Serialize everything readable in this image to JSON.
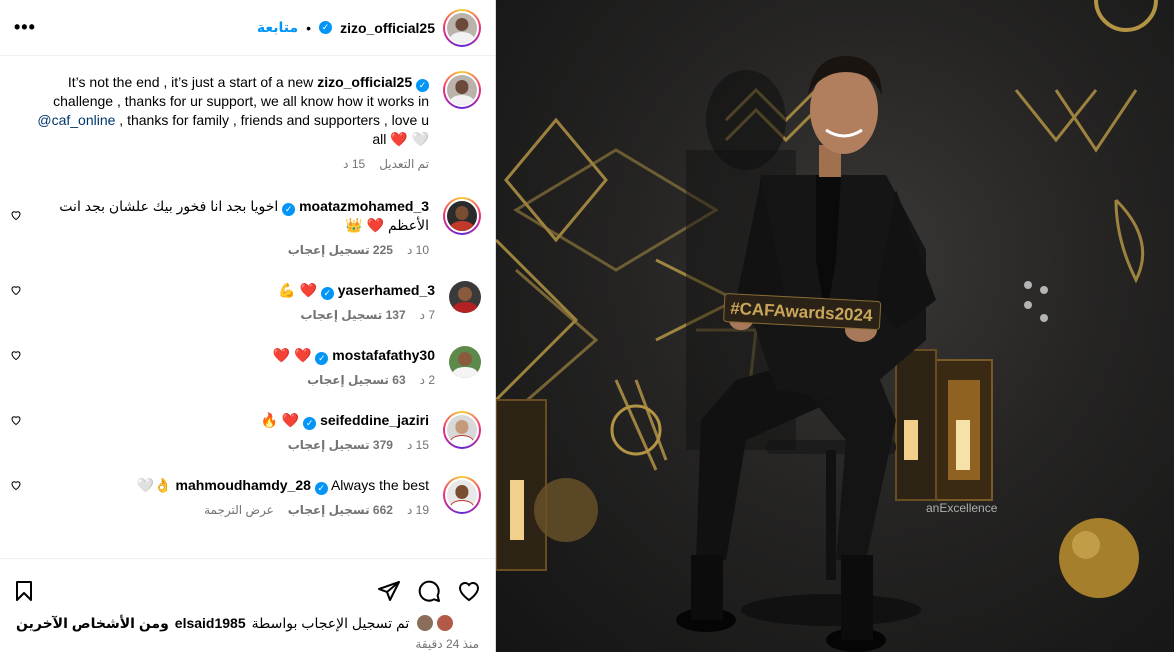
{
  "header": {
    "username": "zizo_official25",
    "dot": "•",
    "follow_label": "متابعة",
    "more_icon": "more-dots-icon",
    "more_glyph": "•••"
  },
  "caption": {
    "username": "zizo_official25",
    "line1": "It’s not the end , it’s just a start of a new",
    "line2": "challenge , thanks for ur support, we all know how it works in",
    "mention": "@caf_online",
    "line3": " , thanks for family , friends and supporters , love u",
    "line4": "all ❤️ 🤍",
    "time": "15 د",
    "edited": "تم التعديل"
  },
  "comments": [
    {
      "username": "moatazmohamed_3",
      "text": "اخويا بجد انا فخور بيك علشان بجد انت",
      "text2": "الأعظم ❤️ 👑",
      "time": "10 د",
      "likes": "225 تسجيل إعجاب",
      "translate": ""
    },
    {
      "username": "yaserhamed_3",
      "text": "❤️ 💪",
      "text2": "",
      "time": "7 د",
      "likes": "137 تسجيل إعجاب",
      "translate": ""
    },
    {
      "username": "mostafafathy30",
      "text": "❤️ ❤️",
      "text2": "",
      "time": "2 د",
      "likes": "63 تسجيل إعجاب",
      "translate": ""
    },
    {
      "username": "seifeddine_jaziri",
      "text": "❤️ 🔥",
      "text2": "",
      "time": "15 د",
      "likes": "379 تسجيل إعجاب",
      "translate": ""
    },
    {
      "username": "mahmoudhamdy_28",
      "text": "Always the best 👌🤍",
      "text2": "",
      "time": "19 د",
      "likes": "662 تسجيل إعجاب",
      "translate": "عرض الترجمة"
    }
  ],
  "actions": {
    "like_icon": "heart-icon",
    "comment_icon": "comment-icon",
    "share_icon": "send-icon",
    "save_icon": "bookmark-icon"
  },
  "liked_by": {
    "prefix": "تم تسجيل الإعجاب بواسطة",
    "user": "elsaid1985",
    "suffix": "ومن الأشخاص الآخرين"
  },
  "posted": "منذ 24 دقيقة",
  "photo": {
    "sign_text": "#CAFAwards2024",
    "backdrop_text": "anExcellence"
  }
}
